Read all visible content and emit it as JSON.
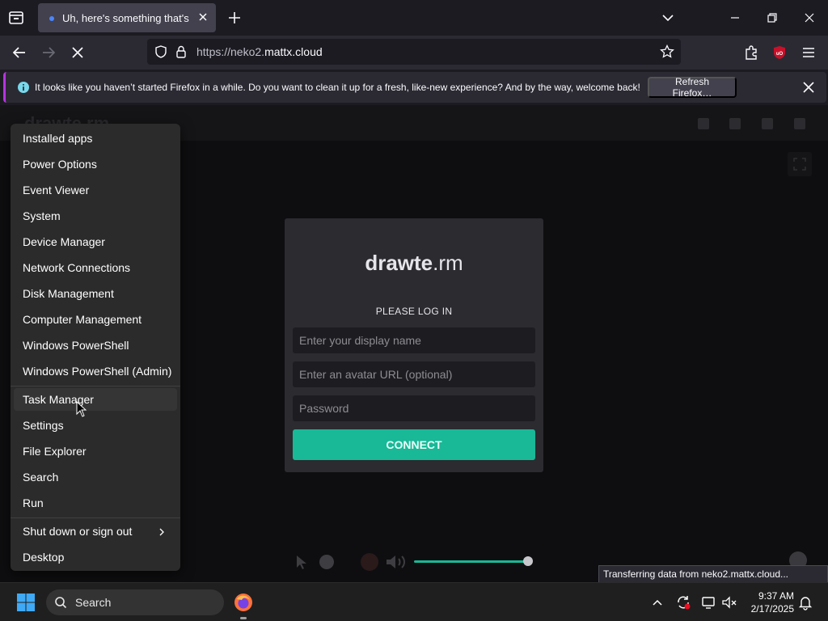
{
  "browser": {
    "tab": {
      "title": "Uh, here's something that's never happened before"
    },
    "url": {
      "prefix": "https://neko2.",
      "domain": "mattx.cloud"
    }
  },
  "notification": {
    "message": "It looks like you haven’t started Firefox in a while. Do you want to clean it up for a fresh, like-new experience? And by the way, welcome back!",
    "button_label": "Refresh Firefox…"
  },
  "page": {
    "brand": "drawte.rm",
    "login": {
      "logo_bold": "drawte",
      "logo_rest": ".rm",
      "heading": "PLEASE LOG IN",
      "display_name_placeholder": "Enter your display name",
      "avatar_placeholder": "Enter an avatar URL (optional)",
      "password_placeholder": "Password",
      "connect_label": "CONNECT"
    },
    "volume": 0.95
  },
  "context_menu": {
    "items": [
      {
        "label": "Installed apps"
      },
      {
        "label": "Power Options"
      },
      {
        "label": "Event Viewer"
      },
      {
        "label": "System"
      },
      {
        "label": "Device Manager"
      },
      {
        "label": "Network Connections"
      },
      {
        "label": "Disk Management"
      },
      {
        "label": "Computer Management"
      },
      {
        "label": "Windows PowerShell"
      },
      {
        "label": "Windows PowerShell (Admin)"
      },
      {
        "label": "Task Manager"
      },
      {
        "label": "Settings"
      },
      {
        "label": "File Explorer"
      },
      {
        "label": "Search"
      },
      {
        "label": "Run"
      },
      {
        "label": "Shut down or sign out"
      },
      {
        "label": "Desktop"
      }
    ],
    "hovered": "Task Manager"
  },
  "status_tip": "Transferring data from neko2.mattx.cloud...",
  "taskbar": {
    "search_label": "Search",
    "time": "9:37 AM",
    "date": "2/17/2025"
  },
  "colors": {
    "accent": "#19b897",
    "notification_accent": "#b833e1",
    "ublock_red": "#c9102a"
  }
}
